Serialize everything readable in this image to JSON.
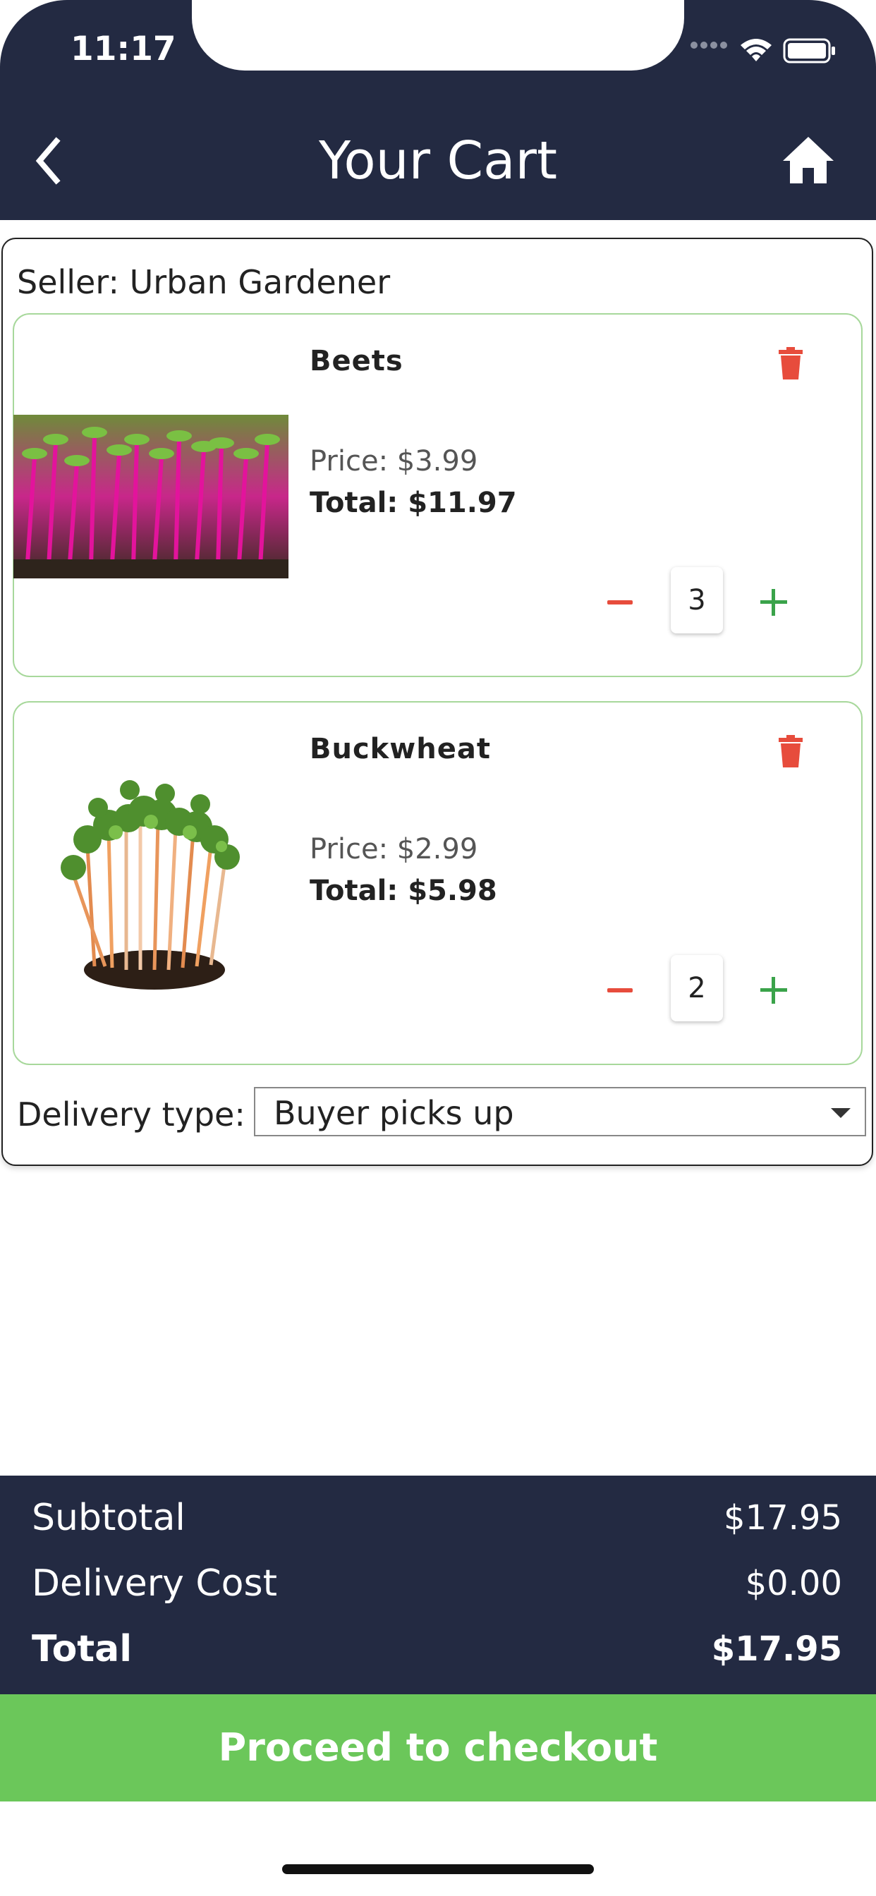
{
  "status": {
    "time": "11:17"
  },
  "header": {
    "title": "Your Cart"
  },
  "seller": {
    "label": "Seller: Urban Gardener"
  },
  "items": [
    {
      "name": "Beets",
      "price_label": "Price:  $3.99",
      "total_label": "Total:  $11.97",
      "quantity": "3"
    },
    {
      "name": "Buckwheat",
      "price_label": "Price:  $2.99",
      "total_label": "Total:  $5.98",
      "quantity": "2"
    }
  ],
  "delivery": {
    "label": "Delivery type:",
    "selected": "Buyer picks up"
  },
  "summary": {
    "subtotal_label": "Subtotal",
    "subtotal_value": "$17.95",
    "delivery_label": "Delivery Cost",
    "delivery_value": "$0.00",
    "total_label": "Total",
    "total_value": "$17.95"
  },
  "checkout": {
    "label": "Proceed to checkout"
  },
  "colors": {
    "navy": "#232a42",
    "green": "#6bc75a",
    "red": "#e74c3c",
    "plus_green": "#3aa34a"
  }
}
